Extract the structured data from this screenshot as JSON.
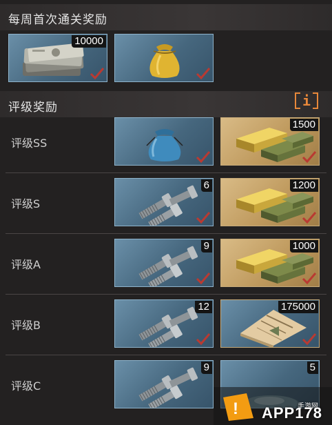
{
  "weekly": {
    "title": "每周首次通关奖励",
    "items": [
      {
        "icon": "cash-stack-icon",
        "qty": "10000"
      },
      {
        "icon": "gold-sack-icon",
        "qty": ""
      }
    ]
  },
  "rating": {
    "title": "评级奖励",
    "info_label": "i",
    "rows": [
      {
        "label": "评级SS",
        "items": [
          {
            "icon": "blue-sack-icon",
            "qty": ""
          },
          {
            "icon": "gold-bars-icon",
            "qty": "1500"
          }
        ]
      },
      {
        "label": "评级S",
        "items": [
          {
            "icon": "bolts-icon",
            "qty": "6"
          },
          {
            "icon": "gold-bars-icon",
            "qty": "1200"
          }
        ]
      },
      {
        "label": "评级A",
        "items": [
          {
            "icon": "bolts-icon",
            "qty": "9"
          },
          {
            "icon": "gold-bars-icon",
            "qty": "1000"
          }
        ]
      },
      {
        "label": "评级B",
        "items": [
          {
            "icon": "bolts-icon",
            "qty": "12"
          },
          {
            "icon": "document-icon",
            "qty": "175000"
          }
        ]
      },
      {
        "label": "评级C",
        "items": [
          {
            "icon": "bolts-icon",
            "qty": "9"
          },
          {
            "icon": "part-icon",
            "qty": "5"
          }
        ]
      }
    ]
  },
  "watermark": {
    "text": "APP178",
    "sub": "手游网"
  },
  "colors": {
    "slot_blue": "#46677e",
    "slot_gold": "#bf9a5e",
    "check": "#c0392b",
    "info": "#e8883a"
  }
}
